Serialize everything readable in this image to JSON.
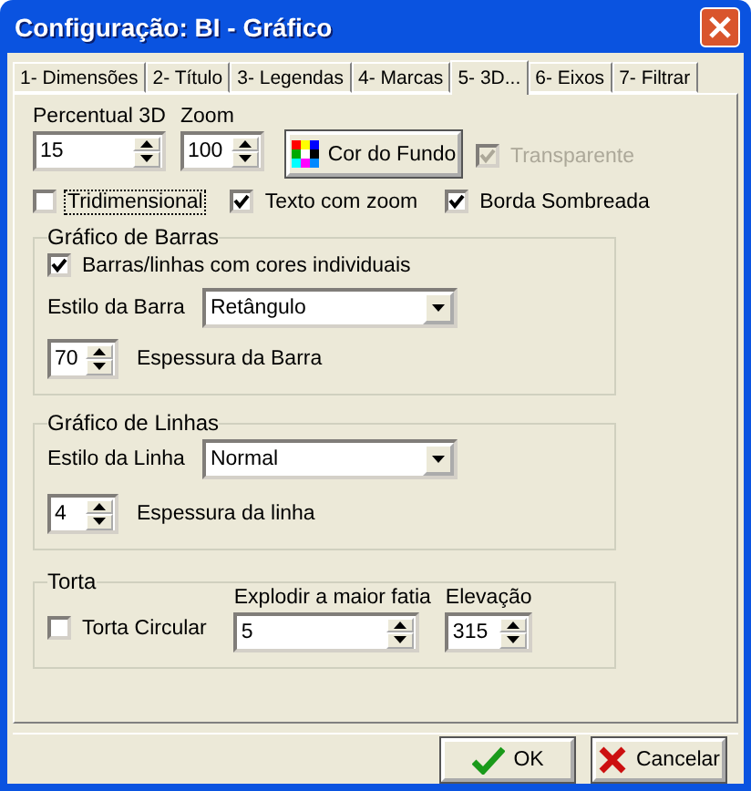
{
  "window": {
    "title": "Configuração: BI - Gráfico"
  },
  "tabs": [
    {
      "label": "1- Dimensões",
      "selected": false
    },
    {
      "label": "2- Título",
      "selected": false
    },
    {
      "label": "3- Legendas",
      "selected": false
    },
    {
      "label": "4- Marcas",
      "selected": false
    },
    {
      "label": "5- 3D...",
      "selected": true
    },
    {
      "label": "6- Eixos",
      "selected": false
    },
    {
      "label": "7- Filtrar",
      "selected": false
    }
  ],
  "percentual": {
    "label": "Percentual 3D",
    "value": "15"
  },
  "zoom": {
    "label": "Zoom",
    "value": "100"
  },
  "color_button": {
    "label": "Cor do Fundo"
  },
  "transparente": {
    "label": "Transparente",
    "checked": true,
    "disabled": true
  },
  "options": [
    {
      "label": "Tridimensional",
      "checked": false,
      "focused": true
    },
    {
      "label": "Texto com zoom",
      "checked": true,
      "focused": false
    },
    {
      "label": "Borda Sombreada",
      "checked": true,
      "focused": false
    }
  ],
  "bar_group": {
    "title": "Gráfico de Barras",
    "individual_colors": {
      "label": "Barras/linhas com cores individuais",
      "checked": true
    },
    "style": {
      "label": "Estilo da Barra",
      "value": "Retângulo"
    },
    "thickness": {
      "value": "70",
      "label": "Espessura da Barra"
    }
  },
  "line_group": {
    "title": "Gráfico de Linhas",
    "style": {
      "label": "Estilo da Linha",
      "value": "Normal"
    },
    "thickness": {
      "value": "4",
      "label": "Espessura da linha"
    }
  },
  "pie_group": {
    "title": "Torta",
    "circular": {
      "label": "Torta Circular",
      "checked": false
    },
    "explode": {
      "label": "Explodir a maior fatia",
      "value": "5"
    },
    "elevation": {
      "label": "Elevação",
      "value": "315"
    }
  },
  "buttons": [
    {
      "label": "OK",
      "kind": "ok"
    },
    {
      "label": "Cancelar",
      "kind": "cancel"
    }
  ]
}
